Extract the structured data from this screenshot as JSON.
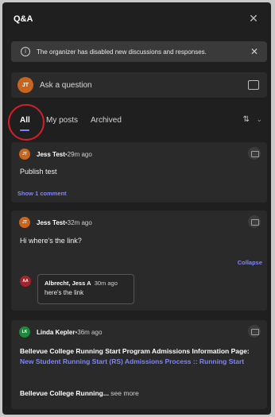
{
  "header": {
    "title": "Q&A",
    "close_glyph": "✕"
  },
  "banner": {
    "info_glyph": "i",
    "text": "The organizer has disabled new discussions and responses.",
    "dismiss_glyph": "✕"
  },
  "ask": {
    "avatar_initials": "JT",
    "placeholder": "Ask a question"
  },
  "tabs": [
    {
      "label": "All",
      "selected": true
    },
    {
      "label": "My posts"
    },
    {
      "label": "Archived"
    }
  ],
  "sort": {
    "icon_glyph": "⇅",
    "chevron_glyph": "⌄"
  },
  "posts": [
    {
      "avatar_initials": "JT",
      "author": "Jess Test",
      "time": "•29m ago",
      "text": "Publish test",
      "show_comments": "Show 1 comment"
    },
    {
      "avatar_initials": "JT",
      "author": "Jess Test",
      "time": "•32m ago",
      "text": "Hi where's the link?",
      "collapse": "Collapse",
      "reply": {
        "avatar_initials": "AA",
        "author": "Albrecht, Jess A",
        "time": "30m ago",
        "text": "here's the link"
      }
    },
    {
      "avatar_initials": "LK",
      "author": "Linda Kepler",
      "time": "•36m ago",
      "rich_prefix": "Bellevue College Running Start Program Admissions Information Page: ",
      "rich_link": "New Student Running Start (RS) Admissions Process :: Running Start",
      "more_prefix": "Bellevue College Running...",
      "see_more": " see more"
    }
  ],
  "colors": {
    "accent": "#7f85f5",
    "highlight": "#d11f2a",
    "avatar_jt": "#c8641d",
    "avatar_aa": "#a3222b",
    "avatar_lk": "#1c8a3a"
  }
}
